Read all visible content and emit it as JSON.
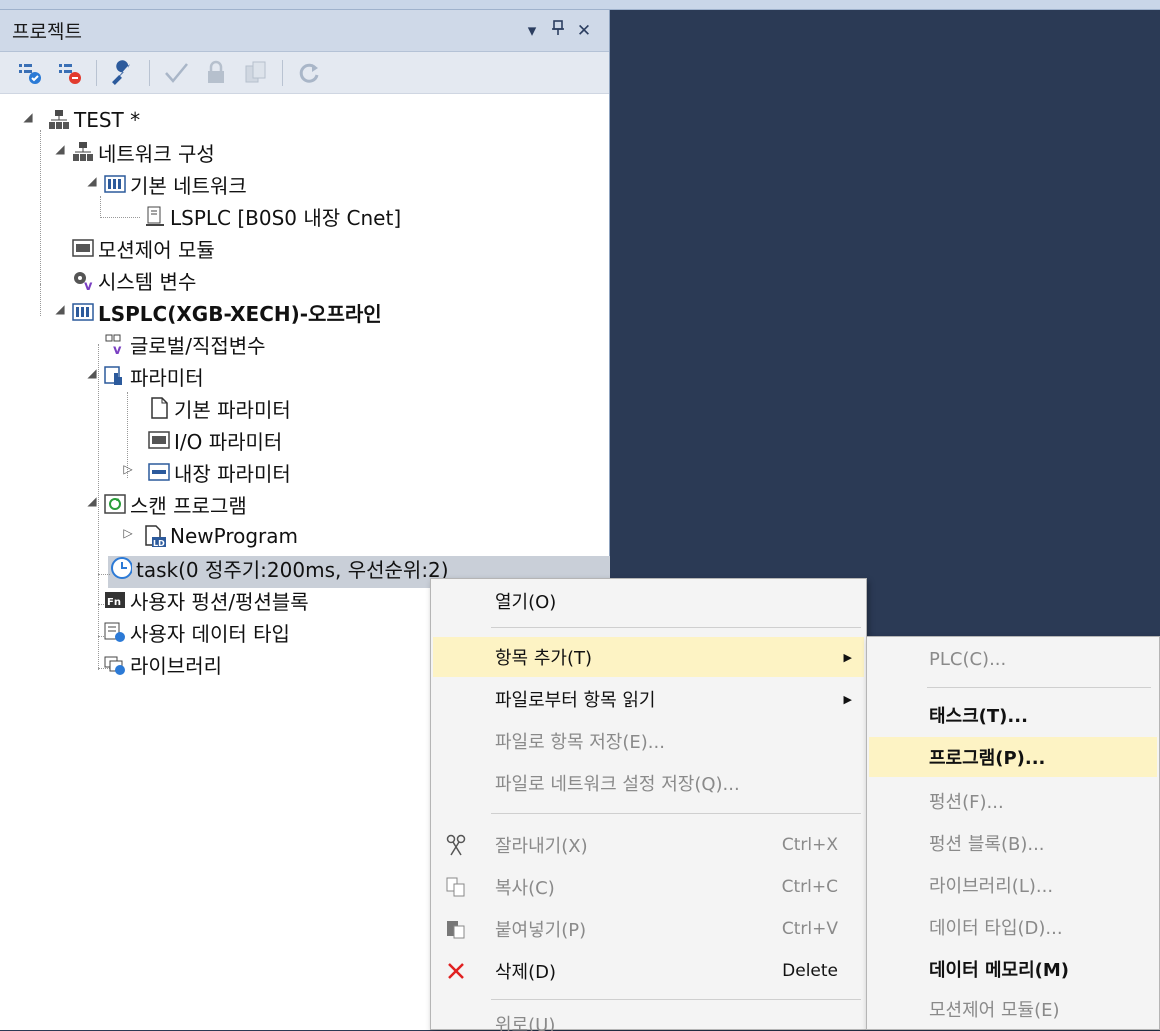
{
  "panel": {
    "title": "프로젝트",
    "pin_glyph": "ㅁ",
    "dropdown_glyph": "▾",
    "close_glyph": "✕"
  },
  "toolbar_icons": [
    "build-all-icon",
    "stop-icon",
    "wrench-icon",
    "check-icon",
    "lock-icon",
    "compare-icon",
    "refresh-icon"
  ],
  "tree": {
    "root": "TEST *",
    "network_config": "네트워크 구성",
    "basic_network": "기본 네트워크",
    "lsplc_cnet": "LSPLC [B0S0 내장 Cnet]",
    "motion_module": "모션제어 모듈",
    "system_vars": "시스템 변수",
    "plc": "LSPLC(XGB-XECH)-오프라인",
    "global_vars": "글로벌/직접변수",
    "parameters": "파라미터",
    "basic_param": "기본 파라미터",
    "io_param": "I/O 파라미터",
    "builtin_param": "내장 파라미터",
    "scan_program": "스캔 프로그램",
    "new_program": "NewProgram",
    "task": "task(0 정주기:200ms, 우선순위:2)",
    "user_function": "사용자 펑션/펑션블록",
    "user_datatype": "사용자 데이터 타입",
    "library": "라이브러리"
  },
  "context_menu": {
    "open": "열기(O)",
    "add_item": "항목 추가(T)",
    "read_from_file": "파일로부터 항목 읽기",
    "save_to_file": "파일로 항목 저장(E)...",
    "save_network": "파일로 네트워크 설정 저장(Q)...",
    "cut": "잘라내기(X)",
    "cut_short": "Ctrl+X",
    "copy": "복사(C)",
    "copy_short": "Ctrl+C",
    "paste": "붙여넣기(P)",
    "paste_short": "Ctrl+V",
    "delete": "삭제(D)",
    "delete_short": "Delete",
    "up": "위로(U)"
  },
  "submenu": {
    "plc": "PLC(C)...",
    "task": "태스크(T)...",
    "program": "프로그램(P)...",
    "function": "펑션(F)...",
    "function_block": "펑션 블록(B)...",
    "library": "라이브러리(L)...",
    "data_type": "데이터 타입(D)...",
    "data_memory": "데이터 메모리(M)",
    "motion_module": "모션제어 모듈(E)"
  },
  "colors": {
    "editor_bg": "#2b3a55",
    "menu_highlight": "#fdf3c4",
    "selected_row": "#c9cfd8"
  }
}
